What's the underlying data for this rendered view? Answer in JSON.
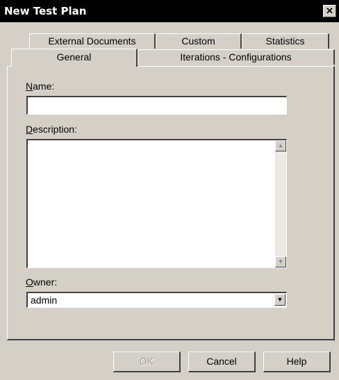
{
  "window": {
    "title": "New Test Plan",
    "close_glyph": "✕"
  },
  "tabs": {
    "back_row": [
      "External Documents",
      "Custom",
      "Statistics"
    ],
    "front_row": [
      "General",
      "Iterations - Configurations"
    ],
    "active": "General"
  },
  "form": {
    "name": {
      "label_hotkey": "N",
      "label_rest": "ame:",
      "value": ""
    },
    "description": {
      "label_hotkey": "D",
      "label_rest": "escription:",
      "value": ""
    },
    "owner": {
      "label_hotkey": "O",
      "label_rest": "wner:",
      "value": "admin"
    }
  },
  "buttons": {
    "ok": "OK",
    "cancel": "Cancel",
    "help": "Help"
  },
  "icons": {
    "scroll_up": "▲",
    "scroll_down": "▼",
    "dropdown": "▼"
  }
}
